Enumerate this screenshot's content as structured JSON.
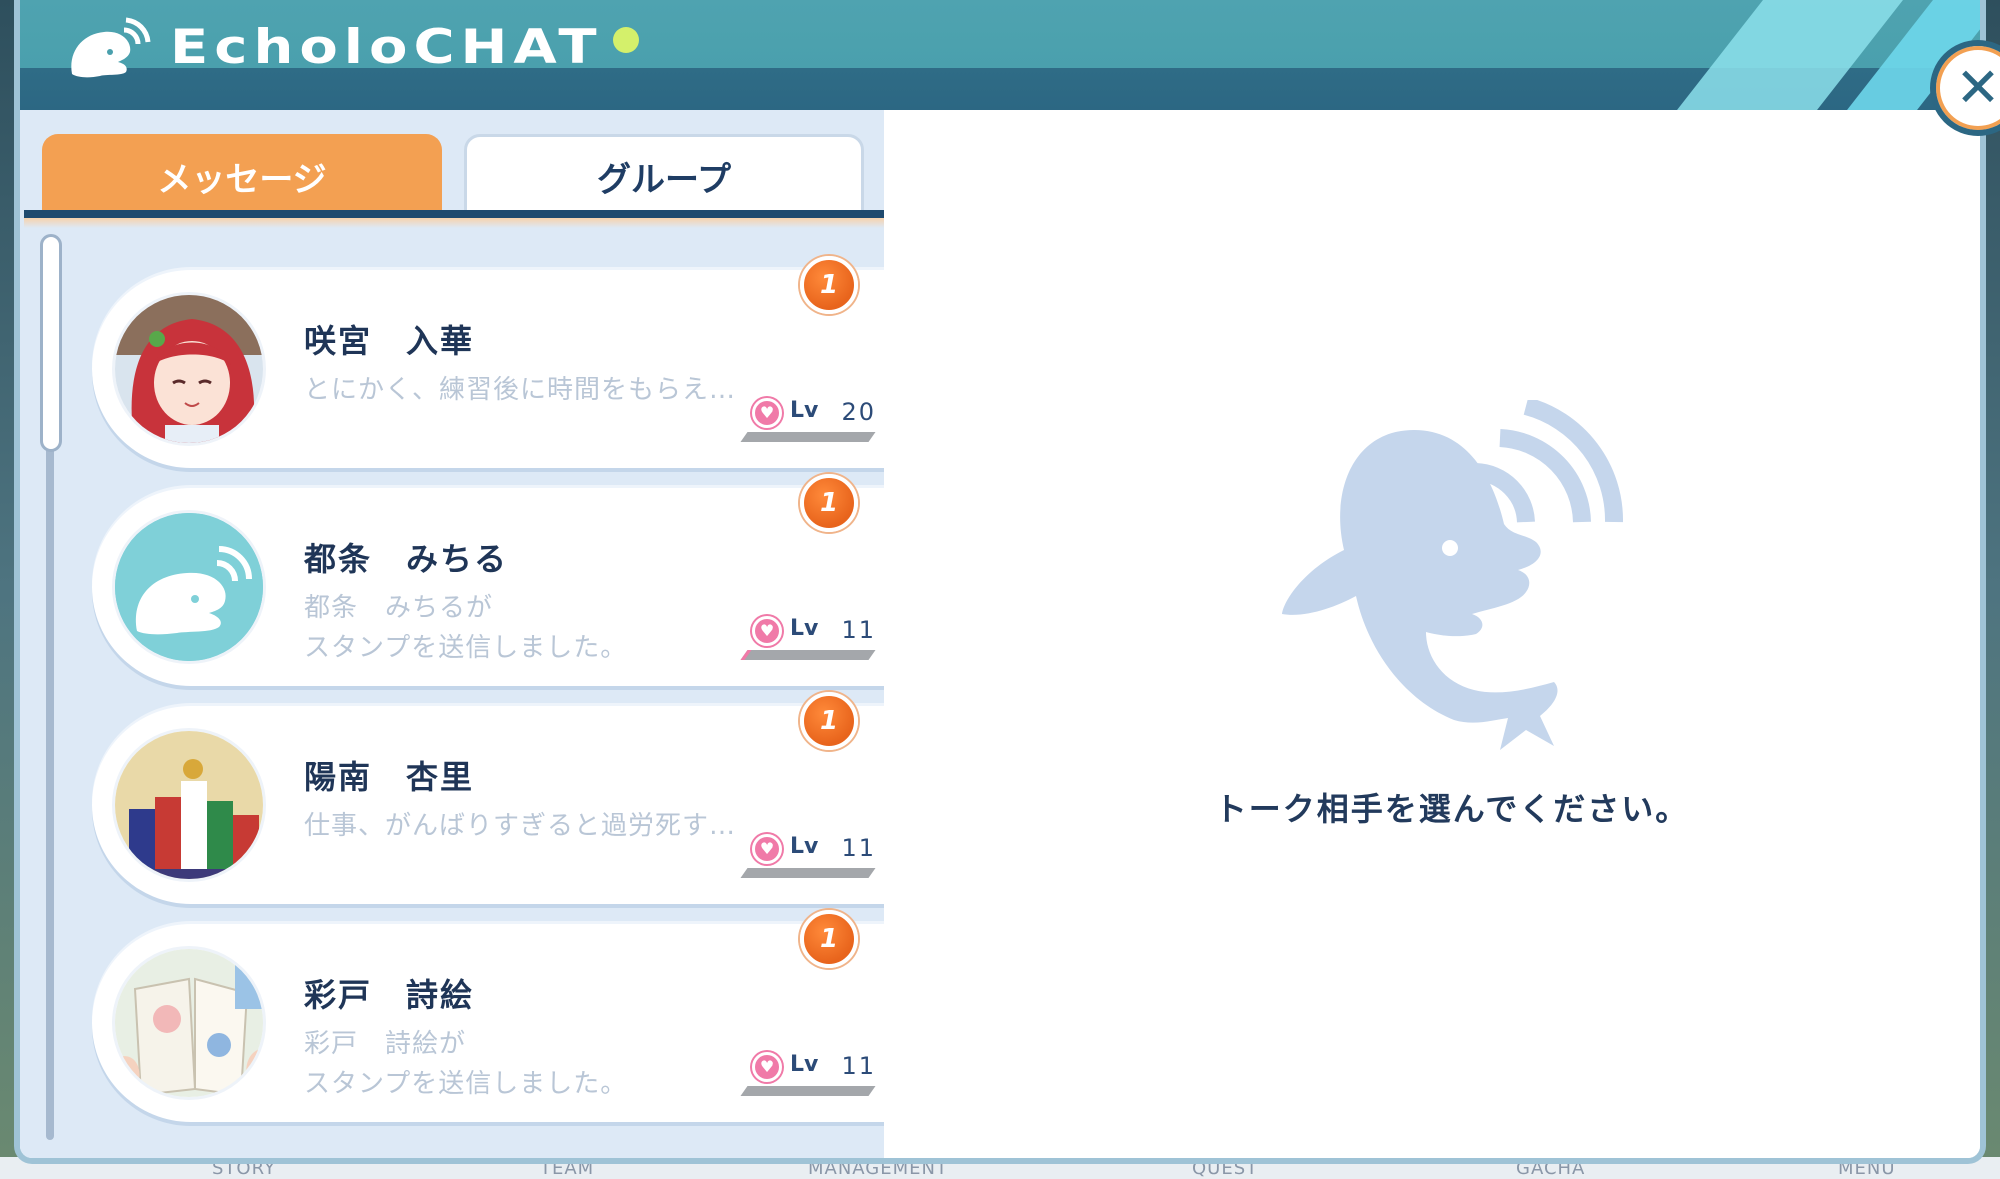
{
  "app": {
    "logo_text": "EcholoCHAT",
    "close_icon": "close-icon"
  },
  "tabs": [
    {
      "label": "メッセージ",
      "active": true
    },
    {
      "label": "グループ",
      "active": false
    }
  ],
  "contacts": [
    {
      "name": "咲宮　入華",
      "preview": "とにかく、練習後に時間をもらえ…",
      "unread": "1",
      "level_label": "Lv",
      "level": "20",
      "affinity_progress": 0.0,
      "avatar": "red-hair-girl-avatar"
    },
    {
      "name": "都条　みちる",
      "preview": "都条　みちるが\nスタンプを送信しました。",
      "unread": "1",
      "level_label": "Lv",
      "level": "11",
      "affinity_progress": 0.03,
      "avatar": "dolphin-default-avatar"
    },
    {
      "name": "陽南　杏里",
      "preview": "仕事、がんばりすぎると過労死す…",
      "unread": "1",
      "level_label": "Lv",
      "level": "11",
      "affinity_progress": 0.0,
      "avatar": "casino-chips-avatar"
    },
    {
      "name": "彩戸　詩絵",
      "preview": "彩戸　詩絵が\nスタンプを送信しました。",
      "unread": "1",
      "level_label": "Lv",
      "level": "11",
      "affinity_progress": 0.0,
      "avatar": "sketchbook-avatar"
    }
  ],
  "empty_state": {
    "message": "トーク相手を選んでください。",
    "icon": "dolphin-echo-icon"
  },
  "background_nav": [
    "STORY",
    "TEAM",
    "MANAGEMENT",
    "QUEST",
    "GACHA",
    "MENU"
  ],
  "colors": {
    "header": "#4aa0ad",
    "header_dark": "#2c6783",
    "active_tab": "#f3a052",
    "badge": "#e8641c",
    "heart": "#f07aa8",
    "panel_bg": "#dde9f6",
    "dolphin": "#c5d6ec"
  }
}
